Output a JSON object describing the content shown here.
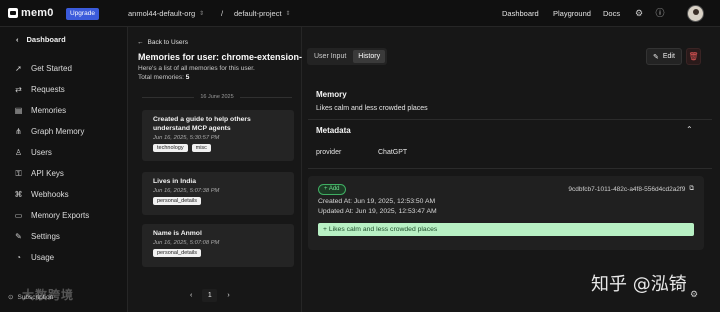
{
  "topbar": {
    "logo_text": "mem0",
    "upgrade_label": "Upgrade",
    "org": "anmol44-default-org",
    "separator": "/",
    "project": "default-project",
    "nav": [
      "Dashboard",
      "Playground",
      "Docs"
    ],
    "icons": [
      "gear-icon",
      "info-icon",
      "avatar"
    ]
  },
  "sidebar": {
    "heading": "Dashboard",
    "items": [
      {
        "label": "Get Started",
        "icon": "rocket-icon"
      },
      {
        "label": "Requests",
        "icon": "request-icon"
      },
      {
        "label": "Memories",
        "icon": "memories-icon"
      },
      {
        "label": "Graph Memory",
        "icon": "graph-icon"
      },
      {
        "label": "Users",
        "icon": "user-icon"
      },
      {
        "label": "API Keys",
        "icon": "key-icon"
      },
      {
        "label": "Webhooks",
        "icon": "webhook-icon"
      },
      {
        "label": "Memory Exports",
        "icon": "export-icon"
      },
      {
        "label": "Settings",
        "icon": "settings-icon"
      },
      {
        "label": "Usage",
        "icon": "usage-icon"
      }
    ],
    "subscription_label": "Subscription"
  },
  "list": {
    "back_label": "Back to Users",
    "title": "Memories for user: chrome-extension-user",
    "description": "Here's a list of all memories for this user.",
    "total_label": "Total memories:",
    "total_value": "5",
    "date_label": "16 June 2025",
    "cards": [
      {
        "title": "Created a guide to help others understand MCP agents",
        "date": "Jun 16, 2025, 5:30:57 PM",
        "tags": [
          "technology",
          "misc"
        ]
      },
      {
        "title": "Lives in India",
        "date": "Jun 16, 2025, 5:07:38 PM",
        "tags": [
          "personal_details"
        ]
      },
      {
        "title": "Name is Anmol",
        "date": "Jun 16, 2025, 5:07:08 PM",
        "tags": [
          "personal_details"
        ]
      }
    ],
    "pager": {
      "prev": "‹",
      "page": "1",
      "next": "›"
    }
  },
  "detail": {
    "tabs": [
      "User Input",
      "History"
    ],
    "active_tab": "History",
    "edit_label": "Edit",
    "memory_heading": "Memory",
    "memory_text": "Likes calm and less crowded places",
    "metadata_heading": "Metadata",
    "metadata_key": "provider",
    "metadata_value": "ChatGPT",
    "history": {
      "badge": "+ Add",
      "id": "9cdbfcb7-1011-482c-a4f8-556d4cd2a2f9",
      "created": "Created At: Jun 19, 2025, 12:53:50 AM",
      "updated": "Updated At: Jun 19, 2025, 12:53:47 AM",
      "change": "+ Likes calm and less crowded places"
    }
  },
  "watermarks": {
    "left": "大数跨境",
    "right": "知乎 @泓锜"
  },
  "colors": {
    "upgrade": "#3b5bdb",
    "add_green": "#3fae62",
    "change_bg": "#b8f0c4",
    "delete_red": "#e05555"
  }
}
